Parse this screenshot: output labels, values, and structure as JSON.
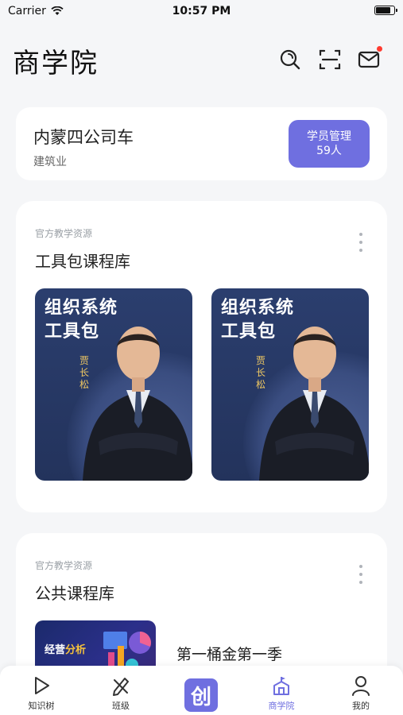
{
  "status_bar": {
    "carrier": "Carrier",
    "time": "10:57 PM",
    "battery_level": 0.9
  },
  "header": {
    "title": "商学院",
    "icons": [
      "search-icon",
      "scan-icon",
      "mail-icon"
    ]
  },
  "organization": {
    "name": "内蒙四公司车",
    "industry": "建筑业",
    "member_button": {
      "label": "学员管理",
      "count": "59人"
    }
  },
  "toolkit_section": {
    "label": "官方教学资源",
    "title": "工具包课程库",
    "courses": [
      {
        "title_line1": "组织系统",
        "title_line2": "工具包",
        "author": "贾长松"
      },
      {
        "title_line1": "组织系统",
        "title_line2": "工具包",
        "author": "贾长松"
      }
    ]
  },
  "public_section": {
    "label": "官方教学资源",
    "title": "公共课程库",
    "courses": [
      {
        "thumb_prefix": "经营",
        "thumb_highlight": "分析",
        "title": "第一桶金第一季"
      }
    ]
  },
  "tabbar": {
    "tabs": [
      {
        "label": "知识树",
        "icon": "play-icon"
      },
      {
        "label": "班级",
        "icon": "pencil-ruler-icon"
      },
      {
        "label": "",
        "icon": "brand-logo",
        "glyph": "创"
      },
      {
        "label": "商学院",
        "icon": "school-icon",
        "active": true
      },
      {
        "label": "我的",
        "icon": "user-icon"
      }
    ]
  },
  "colors": {
    "accent": "#6f6fe0",
    "background": "#f5f6f8",
    "notification": "#ff3b30"
  }
}
